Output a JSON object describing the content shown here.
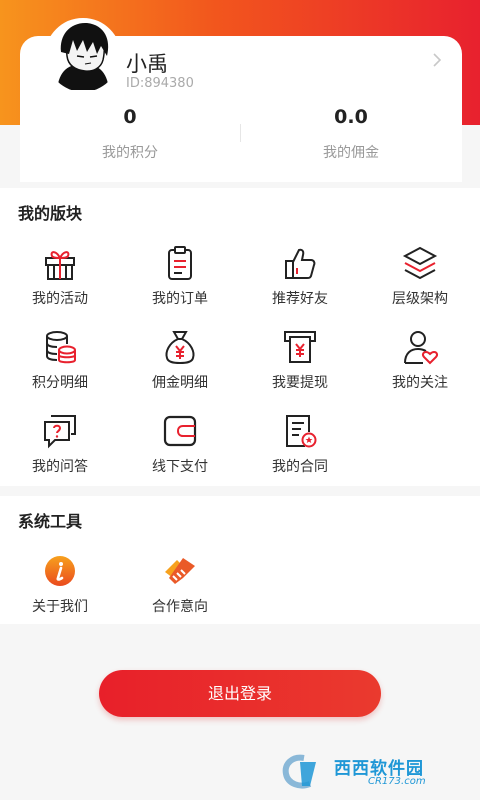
{
  "header": {
    "gradient_colors": [
      "#f7941d",
      "#f2561d",
      "#e8212e"
    ]
  },
  "profile": {
    "name": "小禹",
    "id": "ID:894380",
    "points_value": "0",
    "points_label": "我的积分",
    "commission_value": "0.0",
    "commission_label": "我的佣金"
  },
  "my_section": {
    "title": "我的版块",
    "items": [
      {
        "label": "我的活动",
        "icon": "gift-icon"
      },
      {
        "label": "我的订单",
        "icon": "clipboard-icon"
      },
      {
        "label": "推荐好友",
        "icon": "thumbs-up-icon"
      },
      {
        "label": "层级架构",
        "icon": "layers-icon"
      },
      {
        "label": "积分明细",
        "icon": "coins-stack-icon"
      },
      {
        "label": "佣金明细",
        "icon": "money-bag-icon"
      },
      {
        "label": "我要提现",
        "icon": "withdraw-icon"
      },
      {
        "label": "我的关注",
        "icon": "user-heart-icon"
      },
      {
        "label": "我的问答",
        "icon": "question-chat-icon"
      },
      {
        "label": "线下支付",
        "icon": "wallet-icon"
      },
      {
        "label": "我的合同",
        "icon": "contract-icon"
      }
    ]
  },
  "tools_section": {
    "title": "系统工具",
    "items": [
      {
        "label": "关于我们",
        "icon": "info-icon"
      },
      {
        "label": "合作意向",
        "icon": "handshake-icon"
      }
    ]
  },
  "logout_label": "退出登录",
  "watermark": {
    "main": "西西软件园",
    "sub": "CR173.com"
  },
  "accent_color": "#e8212e"
}
